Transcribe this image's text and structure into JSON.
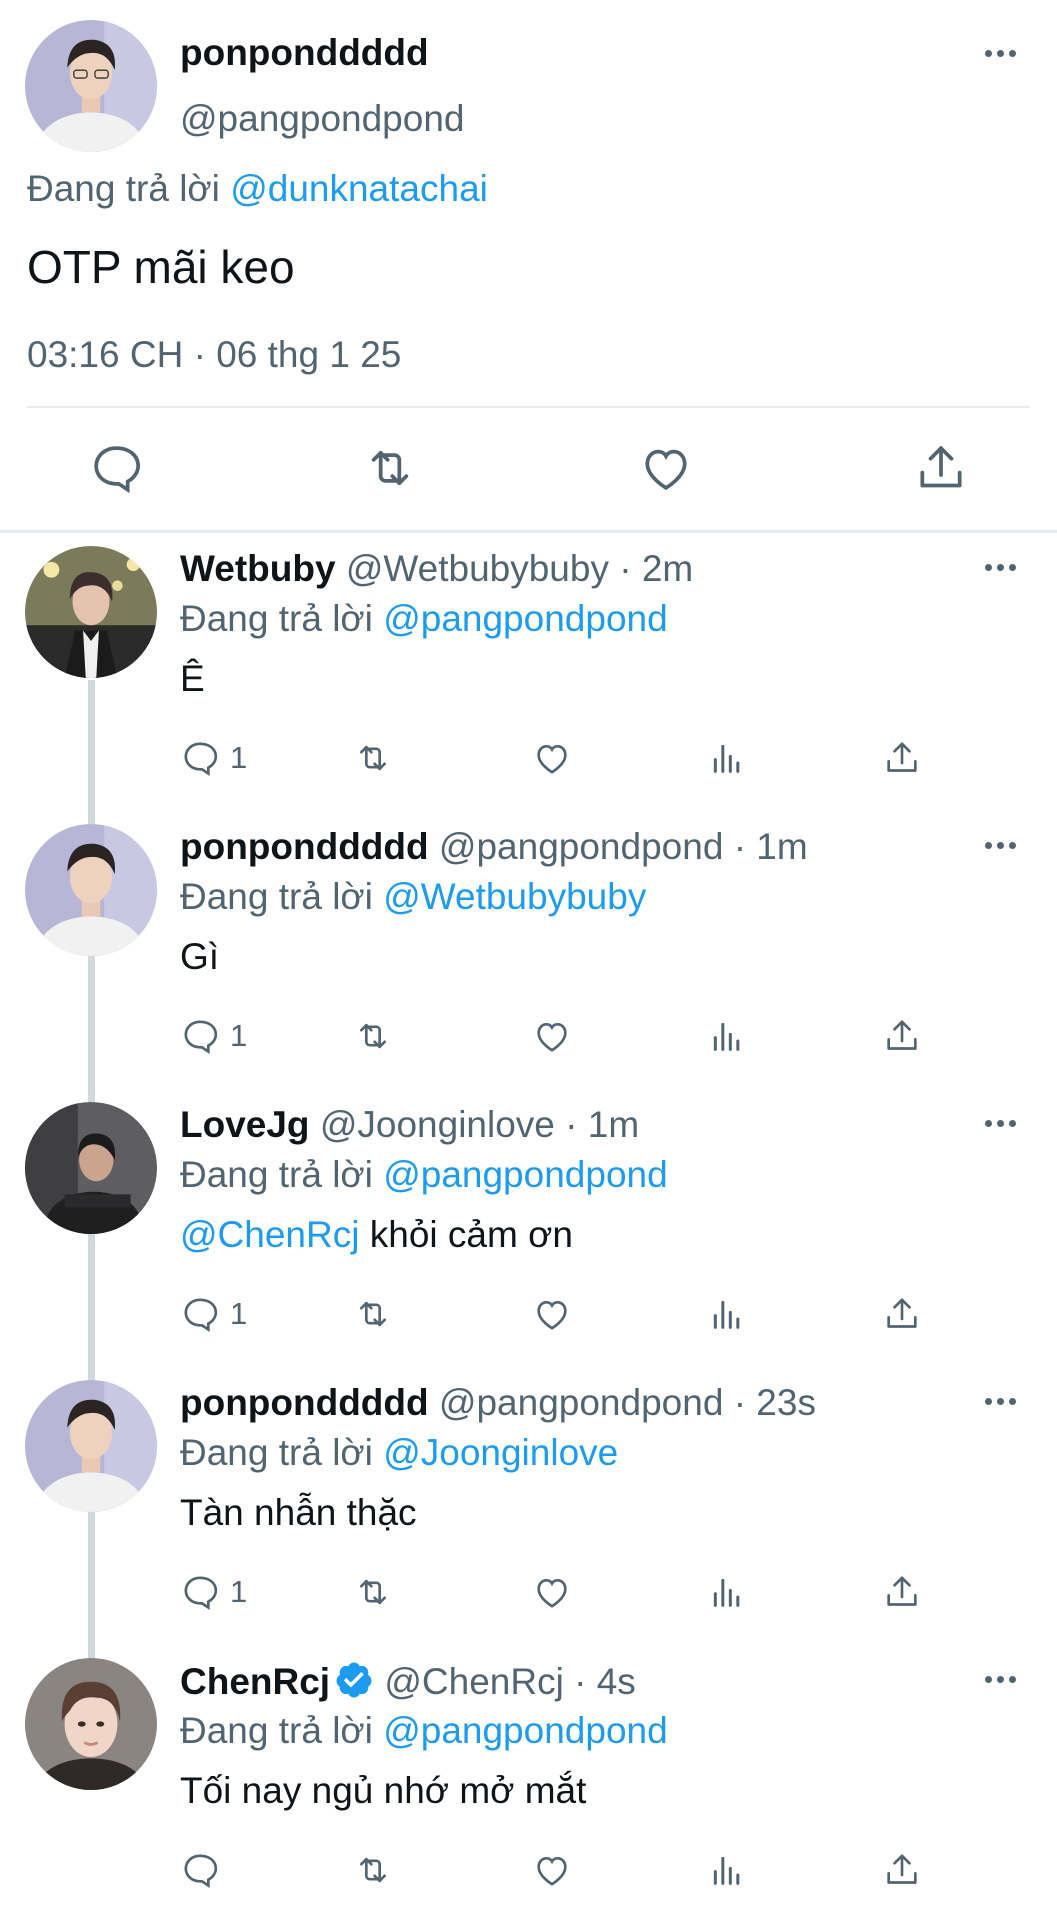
{
  "main_tweet": {
    "display_name": "ponponddddd",
    "handle": "@pangpondpond",
    "replying_prefix": "Đang trả lời",
    "replying_to": "@dunknatachai",
    "text": "OTP mãi keo",
    "timestamp": "03:16 CH · 06 thg 1 25",
    "actions": [
      "reply-icon",
      "retweet-icon",
      "like-icon",
      "share-icon"
    ]
  },
  "replies": [
    {
      "display_name": "Wetbuby",
      "handle": "@Wetbubybuby",
      "time": "· 2m",
      "replying_prefix": "Đang trả lời",
      "replying_to": "@pangpondpond",
      "mention": "",
      "text": "Ê",
      "reply_count": "1"
    },
    {
      "display_name": "ponponddddd",
      "handle": "@pangpondpond",
      "time": "· 1m",
      "replying_prefix": "Đang trả lời",
      "replying_to": "@Wetbubybuby",
      "mention": "",
      "text": "Gì",
      "reply_count": "1"
    },
    {
      "display_name": "LoveJg",
      "handle": "@Joonginlove",
      "time": "· 1m",
      "replying_prefix": "Đang trả lời",
      "replying_to": "@pangpondpond",
      "mention": "@ChenRcj",
      "text": " khỏi cảm ơn",
      "reply_count": "1"
    },
    {
      "display_name": "ponponddddd",
      "handle": "@pangpondpond",
      "time": "· 23s",
      "replying_prefix": "Đang trả lời",
      "replying_to": "@Joonginlove",
      "mention": "",
      "text": "Tàn nhẫn thặc",
      "reply_count": "1"
    },
    {
      "display_name": "ChenRcj",
      "handle": "@ChenRcj",
      "time": "· 4s",
      "verified": true,
      "replying_prefix": "Đang trả lời",
      "replying_to": "@pangpondpond",
      "mention": "",
      "text": "Tối nay ngủ nhớ mở mắt",
      "reply_count": ""
    }
  ],
  "colors": {
    "accent": "#1d9bf0",
    "secondary_text": "#536471",
    "divider": "#e6ecf0",
    "thread_line": "#cfd9de"
  }
}
